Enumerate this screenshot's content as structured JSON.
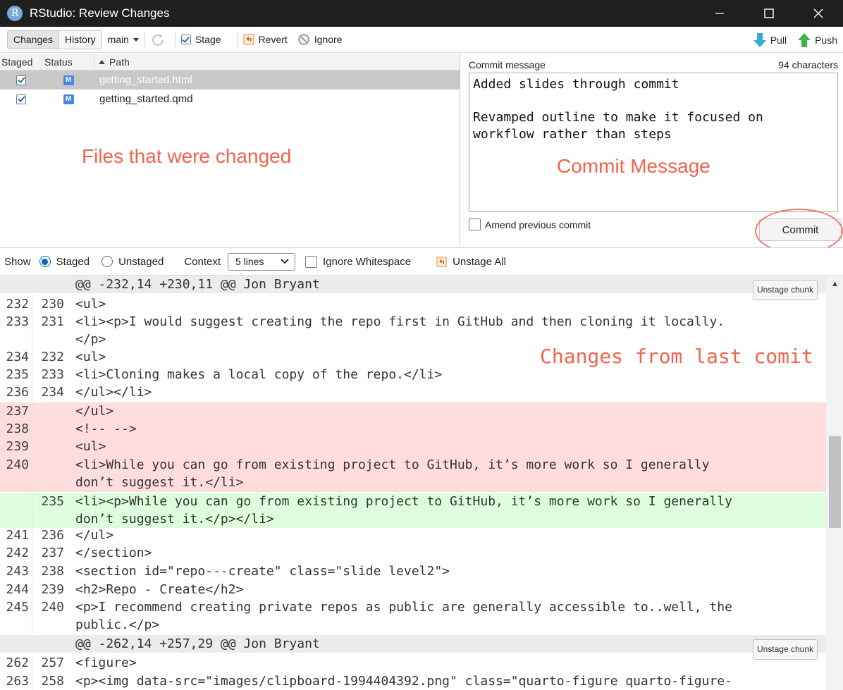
{
  "window": {
    "title": "RStudio: Review Changes",
    "app_icon_letter": "R"
  },
  "toolbar": {
    "tabs": [
      "Changes",
      "History"
    ],
    "branch": "main",
    "stage_label": "Stage",
    "revert_label": "Revert",
    "ignore_label": "Ignore",
    "pull_label": "Pull",
    "push_label": "Push"
  },
  "files": {
    "headers": {
      "staged": "Staged",
      "status": "Status",
      "path": "Path"
    },
    "rows": [
      {
        "staged": true,
        "status": "M",
        "path": "getting_started.html",
        "selected": true
      },
      {
        "staged": true,
        "status": "M",
        "path": "getting_started.qmd",
        "selected": false
      }
    ],
    "annotation": "Files that were changed"
  },
  "commit": {
    "label": "Commit message",
    "count": "94 characters",
    "message": "Added slides through commit\n\nRevamped outline to make it focused on\nworkflow rather than steps",
    "annotation": "Commit Message",
    "amend_label": "Amend previous commit",
    "commit_label": "Commit"
  },
  "diff_toolbar": {
    "show_label": "Show",
    "staged_label": "Staged",
    "unstaged_label": "Unstaged",
    "context_label": "Context",
    "context_value": "5 lines",
    "ignore_ws_label": "Ignore Whitespace",
    "unstage_all_label": "Unstage All"
  },
  "diff": {
    "annotation": "Changes from last comit",
    "unstage_chunk_label": "Unstage chunk",
    "hunk1": "@@ -232,14 +230,11 @@ Jon Bryant",
    "hunk2": "@@ -262,14 +257,29 @@ Jon Bryant",
    "lines": [
      {
        "old": "232",
        "new": "230",
        "type": "ctx",
        "text": "<ul>"
      },
      {
        "old": "233",
        "new": "231",
        "type": "ctx",
        "text": "<li><p>I would suggest creating the repo first in GitHub and then cloning it locally.\n</p>"
      },
      {
        "old": "234",
        "new": "232",
        "type": "ctx",
        "text": "<ul>"
      },
      {
        "old": "235",
        "new": "233",
        "type": "ctx",
        "text": "<li>Cloning makes a local copy of the repo.</li>"
      },
      {
        "old": "236",
        "new": "234",
        "type": "ctx",
        "text": "</ul></li>"
      },
      {
        "old": "237",
        "new": "",
        "type": "del",
        "text": "</ul>"
      },
      {
        "old": "238",
        "new": "",
        "type": "del",
        "text": "<!-- -->"
      },
      {
        "old": "239",
        "new": "",
        "type": "del",
        "text": "<ul>"
      },
      {
        "old": "240",
        "new": "",
        "type": "del",
        "text": "<li>While you can go from existing project to GitHub, it’s more work so I generally\ndon’t suggest it.</li>"
      },
      {
        "old": "",
        "new": "235",
        "type": "ins",
        "text": "<li><p>While you can go from existing project to GitHub, it’s more work so I generally\ndon’t suggest it.</p></li>"
      },
      {
        "old": "241",
        "new": "236",
        "type": "ctx",
        "text": "</ul>"
      },
      {
        "old": "242",
        "new": "237",
        "type": "ctx",
        "text": "</section>"
      },
      {
        "old": "243",
        "new": "238",
        "type": "ctx",
        "text": "<section id=\"repo---create\" class=\"slide level2\">"
      },
      {
        "old": "244",
        "new": "239",
        "type": "ctx",
        "text": "<h2>Repo - Create</h2>"
      },
      {
        "old": "245",
        "new": "240",
        "type": "ctx",
        "text": "<p>I recommend creating private repos as public are generally accessible to..well, the\npublic.</p>"
      },
      {
        "old": "262",
        "new": "257",
        "type": "ctx",
        "text": "<figure>"
      },
      {
        "old": "263",
        "new": "258",
        "type": "ctx",
        "text": "<p><img data-src=\"images/clipboard-1994404392.png\" class=\"quarto-figure quarto-figure-"
      }
    ]
  }
}
